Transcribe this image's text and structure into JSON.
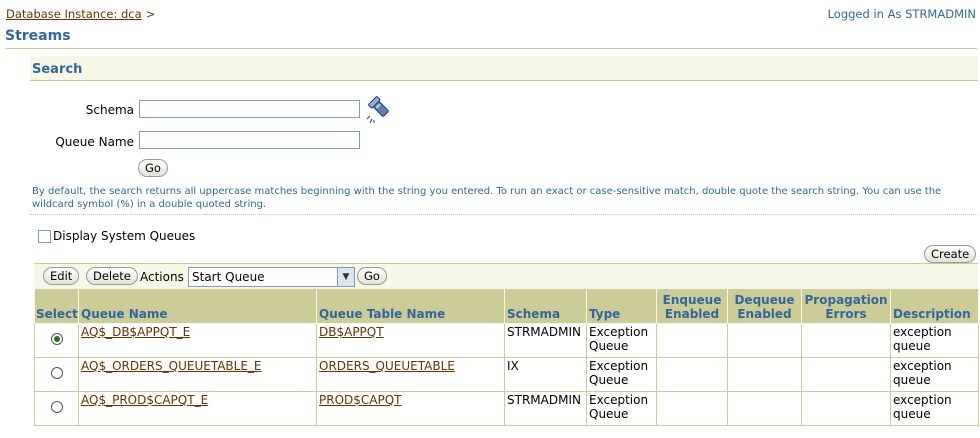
{
  "header": {
    "breadcrumb": "Database Instance: dca",
    "breadcrumb_sep": ">",
    "logged_in": "Logged in As STRMADMIN"
  },
  "page_title": "Streams",
  "search": {
    "title": "Search",
    "schema_label": "Schema",
    "schema_value": "",
    "queue_label": "Queue Name",
    "queue_value": "",
    "go_label": "Go",
    "hint": "By default, the search returns all uppercase matches beginning with the string you entered. To run an exact or case-sensitive match, double quote the search string. You can use the wildcard symbol (%) in a double quoted string.",
    "flashlight_icon": "flashlight-icon"
  },
  "options": {
    "display_system_queues": "Display System Queues",
    "display_system_queues_checked": false
  },
  "toolbar": {
    "create": "Create",
    "edit": "Edit",
    "delete": "Delete",
    "actions_label": "Actions",
    "action_selected": "Start Queue",
    "go": "Go"
  },
  "table": {
    "headers": {
      "select": "Select",
      "queue_name": "Queue Name",
      "queue_table_name": "Queue Table Name",
      "schema": "Schema",
      "type": "Type",
      "enqueue": "Enqueue Enabled",
      "dequeue": "Dequeue Enabled",
      "propagation": "Propagation Errors",
      "description": "Description"
    },
    "rows": [
      {
        "selected": true,
        "queue_name": "AQ$_DB$APPQT_E",
        "queue_table": "DB$APPQT",
        "schema": "STRMADMIN",
        "type": "Exception Queue",
        "enqueue": "",
        "dequeue": "",
        "propagation": "",
        "description": "exception queue"
      },
      {
        "selected": false,
        "queue_name": "AQ$_ORDERS_QUEUETABLE_E",
        "queue_table": "ORDERS_QUEUETABLE",
        "schema": "IX",
        "type": "Exception Queue",
        "enqueue": "",
        "dequeue": "",
        "propagation": "",
        "description": "exception queue"
      },
      {
        "selected": false,
        "queue_name": "AQ$_PROD$CAPQT_E",
        "queue_table": "PROD$CAPQT",
        "schema": "STRMADMIN",
        "type": "Exception Queue",
        "enqueue": "",
        "dequeue": "",
        "propagation": "",
        "description": "exception queue"
      }
    ]
  },
  "colors": {
    "accent": "#336699",
    "link": "#663300",
    "header_bg": "#cccc99",
    "band_bg": "#f7f7e7"
  }
}
